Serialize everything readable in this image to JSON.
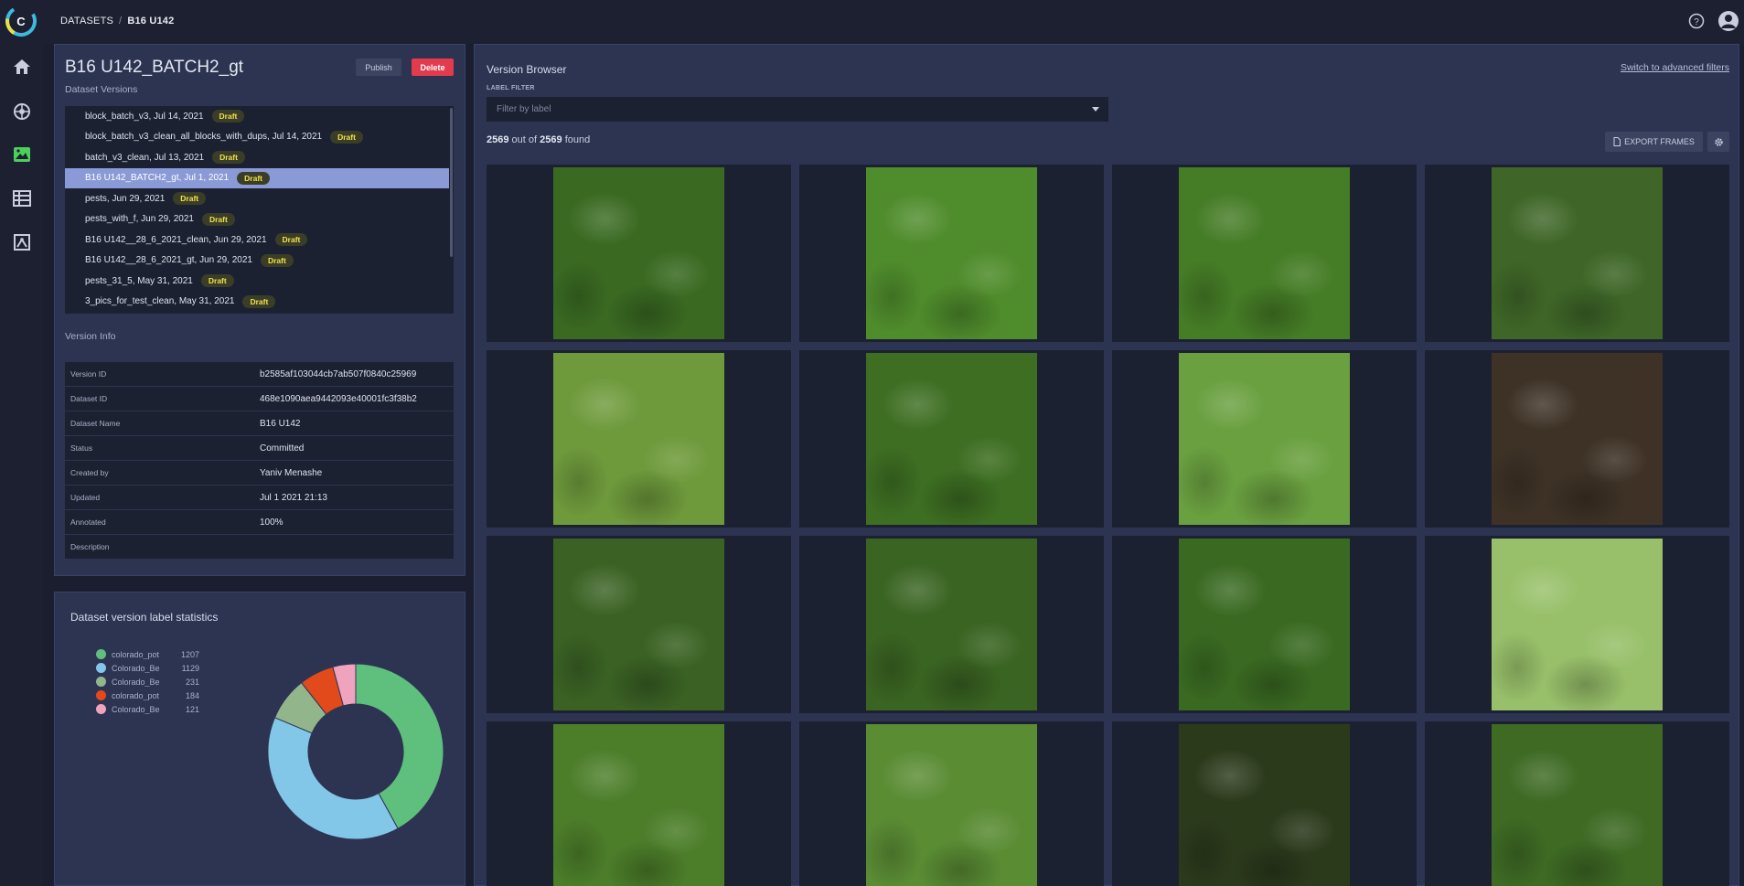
{
  "breadcrumb": {
    "root": "DATASETS",
    "current": "B16 U142"
  },
  "dataset": {
    "title": "B16 U142_BATCH2_gt",
    "publish_label": "Publish",
    "delete_label": "Delete",
    "versions_label": "Dataset Versions",
    "versions": [
      {
        "name": "block_batch_v3, Jul 14, 2021",
        "status": "Draft",
        "selected": false
      },
      {
        "name": "block_batch_v3_clean_all_blocks_with_dups, Jul 14, 2021",
        "status": "Draft",
        "selected": false
      },
      {
        "name": "batch_v3_clean, Jul 13, 2021",
        "status": "Draft",
        "selected": false
      },
      {
        "name": "B16 U142_BATCH2_gt, Jul 1, 2021",
        "status": "Draft",
        "selected": true
      },
      {
        "name": "pests, Jun 29, 2021",
        "status": "Draft",
        "selected": false
      },
      {
        "name": "pests_with_f, Jun 29, 2021",
        "status": "Draft",
        "selected": false
      },
      {
        "name": "B16 U142__28_6_2021_clean, Jun 29, 2021",
        "status": "Draft",
        "selected": false
      },
      {
        "name": "B16 U142__28_6_2021_gt, Jun 29, 2021",
        "status": "Draft",
        "selected": false
      },
      {
        "name": "pests_31_5, May 31, 2021",
        "status": "Draft",
        "selected": false
      },
      {
        "name": "3_pics_for_test_clean, May 31, 2021",
        "status": "Draft",
        "selected": false
      }
    ],
    "version_info_label": "Version Info",
    "info": [
      {
        "key": "Version ID",
        "value": "b2585af103044cb7ab507f0840c25969"
      },
      {
        "key": "Dataset ID",
        "value": "468e1090aea9442093e40001fc3f38b2"
      },
      {
        "key": "Dataset Name",
        "value": "B16 U142"
      },
      {
        "key": "Status",
        "value": "Committed"
      },
      {
        "key": "Created by",
        "value": "Yaniv Menashe"
      },
      {
        "key": "Updated",
        "value": "Jul 1 2021 21:13"
      },
      {
        "key": "Annotated",
        "value": "100%"
      },
      {
        "key": "Description",
        "value": ""
      }
    ]
  },
  "stats": {
    "title": "Dataset version label statistics",
    "chart_data": {
      "type": "pie",
      "labels": [
        "colorado_pot",
        "Colorado_Be",
        "Colorado_Be",
        "colorado_pot",
        "Colorado_Be"
      ],
      "values": [
        1207,
        1129,
        231,
        184,
        121
      ],
      "colors": [
        "#5fbf7d",
        "#82c6e8",
        "#93b58c",
        "#e24a1c",
        "#f0a3bd"
      ]
    }
  },
  "browser": {
    "title": "Version Browser",
    "advanced_link": "Switch to advanced filters",
    "label_filter_label": "LABEL FILTER",
    "label_filter_placeholder": "Filter by label",
    "found_count": "2569",
    "found_total": "2569",
    "found_mid": "out of",
    "found_suffix": "found",
    "export_label": "EXPORT FRAMES",
    "tiles": [
      {
        "tone": "#3a6a22"
      },
      {
        "tone": "#4f8c2c"
      },
      {
        "tone": "#457c26"
      },
      {
        "tone": "#3f6628"
      },
      {
        "tone": "#6f9a3c"
      },
      {
        "tone": "#3d6e22"
      },
      {
        "tone": "#6aa040"
      },
      {
        "tone": "#3e3226"
      },
      {
        "tone": "#3b6224"
      },
      {
        "tone": "#3a6422"
      },
      {
        "tone": "#3a6a22"
      },
      {
        "tone": "#98c06a"
      },
      {
        "tone": "#4c7e2a"
      },
      {
        "tone": "#5a8c34"
      },
      {
        "tone": "#2c3a1c"
      },
      {
        "tone": "#3e6a24"
      }
    ]
  }
}
